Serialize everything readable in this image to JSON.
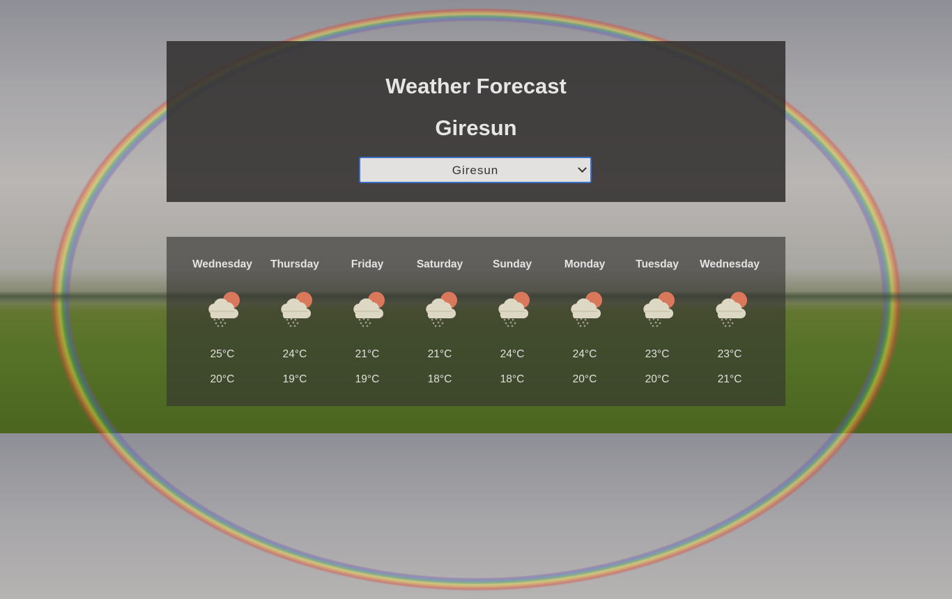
{
  "header": {
    "title": "Weather Forecast",
    "city": "Giresun",
    "select_value": "Giresun"
  },
  "forecast": [
    {
      "day": "Wednesday",
      "high": "25°C",
      "low": "20°C",
      "icon": "cloud-sun-rain-icon"
    },
    {
      "day": "Thursday",
      "high": "24°C",
      "low": "19°C",
      "icon": "cloud-sun-rain-icon"
    },
    {
      "day": "Friday",
      "high": "21°C",
      "low": "19°C",
      "icon": "cloud-sun-rain-icon"
    },
    {
      "day": "Saturday",
      "high": "21°C",
      "low": "18°C",
      "icon": "cloud-sun-rain-icon"
    },
    {
      "day": "Sunday",
      "high": "24°C",
      "low": "18°C",
      "icon": "cloud-sun-rain-icon"
    },
    {
      "day": "Monday",
      "high": "24°C",
      "low": "20°C",
      "icon": "cloud-sun-rain-icon"
    },
    {
      "day": "Tuesday",
      "high": "23°C",
      "low": "20°C",
      "icon": "cloud-sun-rain-icon"
    },
    {
      "day": "Wednesday",
      "high": "23°C",
      "low": "21°C",
      "icon": "cloud-sun-rain-icon"
    }
  ],
  "colors": {
    "select_border": "#3a6ec4",
    "sun": "#d9785a",
    "cloud": "#ddd8c4"
  }
}
